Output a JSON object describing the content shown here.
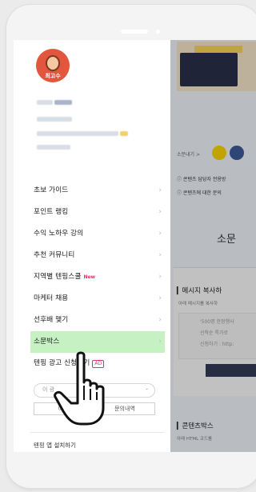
{
  "drawer": {
    "avatar_label": "최고수",
    "menu": [
      {
        "label": "초보 가이드",
        "badge": ""
      },
      {
        "label": "포인트 랭킹",
        "badge": ""
      },
      {
        "label": "수익 노하우 강의",
        "badge": ""
      },
      {
        "label": "추천 커뮤니티",
        "badge": ""
      },
      {
        "label": "지역별 텐핑스쿨",
        "badge": "New"
      },
      {
        "label": "마케터 채용",
        "badge": ""
      },
      {
        "label": "선후배 맺기",
        "badge": ""
      },
      {
        "label": "소문박스",
        "badge": ""
      },
      {
        "label": "텐핑 광고 신청하기",
        "badge": "AD"
      }
    ],
    "active_item": "소문박스",
    "search_placeholder": "이 광",
    "search_suffix": "엄",
    "buttons": {
      "left": "이용",
      "right": "문의내역"
    },
    "install_label": "텐핑 앱 설치하기",
    "chevron": "›"
  },
  "content": {
    "crumb": "소문내기 >",
    "notice1": "콘텐츠 담당자 전용방",
    "notice2": "콘텐츠에 대한 문의",
    "title": "소문",
    "section1_heading": "메시지 복사하",
    "section1_sub": "아래 메시지를 복사하",
    "section1_box": [
      "'500명 한정행사",
      "선착순 특가로 ",
      "신청하기 : http:"
    ],
    "section2_heading": "콘텐츠박스 ",
    "section2_sub": "아래 HTML 코드를 "
  },
  "colors": {
    "active_bg": "#c6f1c3",
    "new_badge": "#e0336b",
    "avatar_bg": "#e1563c"
  }
}
